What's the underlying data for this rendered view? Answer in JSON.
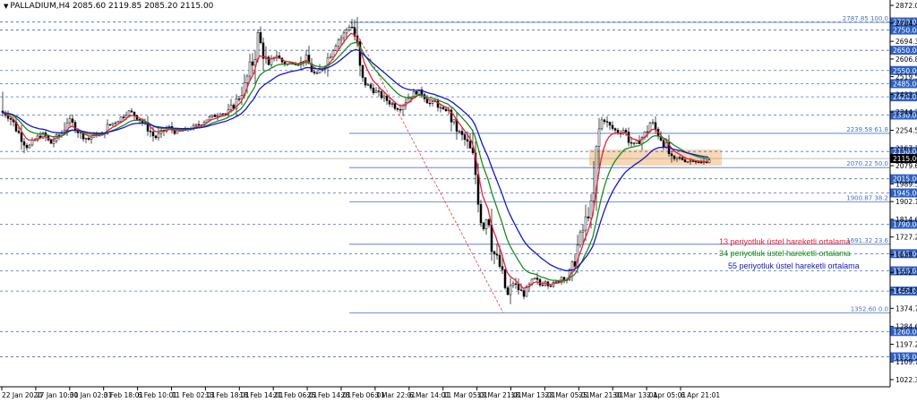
{
  "header": {
    "triangle": "▼",
    "text": "PALLADIUM,H4  2085.60 2119.85 2085.20 2115.00"
  },
  "colors": {
    "ema13": "#e8203a",
    "ema34": "#1a8c1a",
    "ema55": "#1418c8",
    "candle": "#000000",
    "grid_dash": "#4a70c8",
    "fib": "#4a70c8",
    "zone": "#f6c99a",
    "trend": "#e04040",
    "price_box": "#000000",
    "level_box": "#3060c0"
  },
  "chart_data": {
    "type": "candlestick",
    "symbol": "PALLADIUM",
    "timeframe": "H4",
    "ohlc_header": {
      "open": 2085.6,
      "high": 2119.85,
      "low": 2085.2,
      "close": 2115.0
    },
    "ylim": [
      1022.34,
      2872.04
    ],
    "y_tick_labels": [
      "2872.04",
      "2784.49",
      "2694.38",
      "2606.89",
      "2519.59",
      "2432.14",
      "2344.70",
      "2254.59",
      "2167.14",
      "2079.69",
      "1989.59",
      "1902.14",
      "1814.69",
      "1727.24",
      "1639.79",
      "1552.34",
      "1464.89",
      "1374.79",
      "1284.69",
      "1197.24",
      "1109.79",
      "1022.34"
    ],
    "x_tick_labels": [
      "22 Jan 2020",
      "27 Jan 10:01",
      "30 Jan 02:01",
      "3 Feb 18:01",
      "6 Feb 10:01",
      "11 Feb 02:01",
      "13 Feb 18:01",
      "18 Feb 14:01",
      "21 Feb 06:01",
      "25 Feb 14:01",
      "28 Feb 06:01",
      "3 Mar 22:01",
      "6 Mar 14:01",
      "11 Mar 05:01",
      "13 Mar 21:01",
      "18 Mar 13:01",
      "23 Mar 05:01",
      "25 Mar 21:01",
      "30 Mar 13:01",
      "2 Apr 05:01",
      "6 Apr 21:01"
    ],
    "horizontal_levels": [
      {
        "value": 2790.0,
        "label": "2790.00"
      },
      {
        "value": 2750.0,
        "label": "2750.00"
      },
      {
        "value": 2650.0,
        "label": "2650.00"
      },
      {
        "value": 2550.0,
        "label": "2550.00"
      },
      {
        "value": 2485.0,
        "label": "2485.00"
      },
      {
        "value": 2420.0,
        "label": "2420.00"
      },
      {
        "value": 2330.0,
        "label": "2330.00"
      },
      {
        "value": 2150.0,
        "label": "2150.00"
      },
      {
        "value": 2015.0,
        "label": "2015.00"
      },
      {
        "value": 1945.0,
        "label": "1945.00"
      },
      {
        "value": 1790.0,
        "label": "1790.00"
      },
      {
        "value": 1645.0,
        "label": "1645.00"
      },
      {
        "value": 1560.0,
        "label": "1560.00"
      },
      {
        "value": 1460.0,
        "label": "1460.00"
      },
      {
        "value": 1260.0,
        "label": "1260.00"
      },
      {
        "value": 1135.0,
        "label": "1135.00"
      }
    ],
    "current_price": {
      "value": 2115.0,
      "label": "2115.00"
    },
    "fibonacci": [
      {
        "value": 2787.85,
        "label": "2787.85 100.0"
      },
      {
        "value": 2239.58,
        "label": "2239.58 61.8"
      },
      {
        "value": 2070.22,
        "label": "2070.22 50.0"
      },
      {
        "value": 1900.87,
        "label": "1900.87 38.2"
      },
      {
        "value": 1691.32,
        "label": "1691.32 23.6"
      },
      {
        "value": 1352.6,
        "label": "1352.60 0.0"
      }
    ],
    "zone": {
      "from_label": "25 Mar 21:01",
      "to_label": "6 Apr 21:01",
      "top": 2160,
      "bottom": 2080
    },
    "trendline": {
      "from": {
        "x": "28 Feb 06:01",
        "y": 2787.85
      },
      "to": {
        "x": "13 Mar 21:01",
        "y": 1352.6
      }
    },
    "series": [
      {
        "name": "13 periyotluk üstel hareketli ortalama",
        "key": "ema13"
      },
      {
        "name": "34 periyotluk üstel hareketli ortalama",
        "key": "ema34"
      },
      {
        "name": "55 periyotluk üstel hareketli ortalama",
        "key": "ema55"
      }
    ],
    "price_path": [
      [
        0,
        2350
      ],
      [
        10,
        2320
      ],
      [
        20,
        2240
      ],
      [
        30,
        2170
      ],
      [
        35,
        2190
      ],
      [
        40,
        2215
      ],
      [
        48,
        2240
      ],
      [
        55,
        2185
      ],
      [
        60,
        2210
      ],
      [
        68,
        2240
      ],
      [
        75,
        2310
      ],
      [
        83,
        2270
      ],
      [
        90,
        2230
      ],
      [
        98,
        2210
      ],
      [
        105,
        2235
      ],
      [
        112,
        2225
      ],
      [
        118,
        2270
      ],
      [
        125,
        2290
      ],
      [
        135,
        2320
      ],
      [
        142,
        2350
      ],
      [
        150,
        2330
      ],
      [
        157,
        2300
      ],
      [
        165,
        2260
      ],
      [
        172,
        2215
      ],
      [
        180,
        2245
      ],
      [
        188,
        2270
      ],
      [
        195,
        2245
      ],
      [
        205,
        2255
      ],
      [
        215,
        2270
      ],
      [
        222,
        2285
      ],
      [
        230,
        2310
      ],
      [
        238,
        2325
      ],
      [
        246,
        2345
      ],
      [
        252,
        2330
      ],
      [
        260,
        2380
      ],
      [
        266,
        2420
      ],
      [
        272,
        2470
      ],
      [
        278,
        2560
      ],
      [
        282,
        2600
      ],
      [
        287,
        2730
      ],
      [
        291,
        2660
      ],
      [
        296,
        2600
      ],
      [
        300,
        2560
      ],
      [
        306,
        2640
      ],
      [
        312,
        2600
      ],
      [
        318,
        2580
      ],
      [
        326,
        2590
      ],
      [
        334,
        2580
      ],
      [
        340,
        2620
      ],
      [
        346,
        2560
      ],
      [
        352,
        2520
      ],
      [
        358,
        2560
      ],
      [
        364,
        2600
      ],
      [
        370,
        2660
      ],
      [
        376,
        2700
      ],
      [
        382,
        2720
      ],
      [
        387,
        2760
      ],
      [
        391,
        2780
      ],
      [
        395,
        2720
      ],
      [
        398,
        2650
      ],
      [
        402,
        2510
      ],
      [
        408,
        2480
      ],
      [
        414,
        2460
      ],
      [
        420,
        2440
      ],
      [
        426,
        2420
      ],
      [
        432,
        2400
      ],
      [
        438,
        2380
      ],
      [
        444,
        2360
      ],
      [
        450,
        2390
      ],
      [
        456,
        2420
      ],
      [
        462,
        2440
      ],
      [
        468,
        2450
      ],
      [
        474,
        2420
      ],
      [
        480,
        2380
      ],
      [
        486,
        2400
      ],
      [
        492,
        2350
      ],
      [
        498,
        2360
      ],
      [
        504,
        2300
      ],
      [
        510,
        2250
      ],
      [
        516,
        2220
      ],
      [
        522,
        2180
      ],
      [
        528,
        2100
      ],
      [
        533,
        1950
      ],
      [
        538,
        1760
      ],
      [
        544,
        1850
      ],
      [
        550,
        1650
      ],
      [
        556,
        1600
      ],
      [
        562,
        1490
      ],
      [
        566,
        1440
      ],
      [
        572,
        1500
      ],
      [
        578,
        1470
      ],
      [
        584,
        1440
      ],
      [
        590,
        1480
      ],
      [
        596,
        1520
      ],
      [
        602,
        1490
      ],
      [
        608,
        1510
      ],
      [
        614,
        1490
      ],
      [
        620,
        1500
      ],
      [
        626,
        1530
      ],
      [
        632,
        1520
      ],
      [
        638,
        1570
      ],
      [
        644,
        1680
      ],
      [
        650,
        1760
      ],
      [
        656,
        1850
      ],
      [
        662,
        1910
      ],
      [
        667,
        2230
      ],
      [
        672,
        2320
      ],
      [
        678,
        2280
      ],
      [
        684,
        2260
      ],
      [
        690,
        2240
      ],
      [
        696,
        2260
      ],
      [
        702,
        2200
      ],
      [
        708,
        2180
      ],
      [
        714,
        2210
      ],
      [
        720,
        2240
      ],
      [
        726,
        2300
      ],
      [
        732,
        2250
      ],
      [
        738,
        2210
      ],
      [
        744,
        2160
      ],
      [
        750,
        2100
      ],
      [
        756,
        2120
      ],
      [
        762,
        2110
      ],
      [
        768,
        2100
      ],
      [
        774,
        2110
      ],
      [
        780,
        2090
      ],
      [
        786,
        2100
      ],
      [
        792,
        2115
      ]
    ]
  },
  "legend_texts": {
    "ema13": "13 periyotluk üstel hareketli ortalama",
    "ema34": "34 periyotluk üstel hareketli ortalama",
    "ema55": "55 periyotluk üstel hareketli ortalama"
  }
}
